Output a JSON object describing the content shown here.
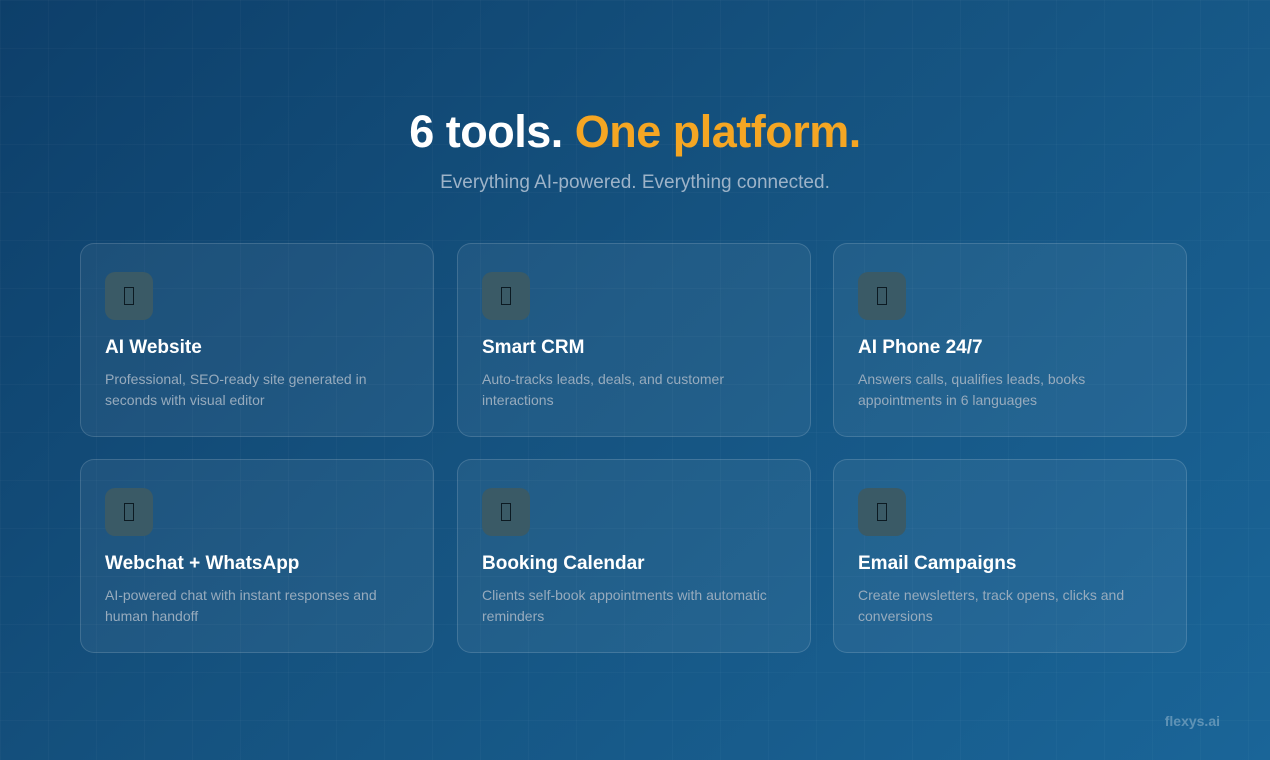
{
  "header": {
    "title_main": "6 tools.",
    "title_accent": "One platform.",
    "subtitle": "Everything AI-powered. Everything connected."
  },
  "colors": {
    "accent": "#f5a623",
    "background_start": "#0d3f6a",
    "background_end": "#1a6598"
  },
  "cards": [
    {
      "icon": "website-icon",
      "title": "AI Website",
      "description": "Professional, SEO-ready site generated in seconds with visual editor"
    },
    {
      "icon": "crm-icon",
      "title": "Smart CRM",
      "description": "Auto-tracks leads, deals, and customer interactions"
    },
    {
      "icon": "phone-icon",
      "title": "AI Phone 24/7",
      "description": "Answers calls, qualifies leads, books appointments in 6 languages"
    },
    {
      "icon": "chat-icon",
      "title": "Webchat + WhatsApp",
      "description": "AI-powered chat with instant responses and human handoff"
    },
    {
      "icon": "calendar-icon",
      "title": "Booking Calendar",
      "description": "Clients self-book appointments with automatic reminders"
    },
    {
      "icon": "email-icon",
      "title": "Email Campaigns",
      "description": "Create newsletters, track opens, clicks and conversions"
    }
  ],
  "footer": {
    "brand": "flexys.ai"
  }
}
